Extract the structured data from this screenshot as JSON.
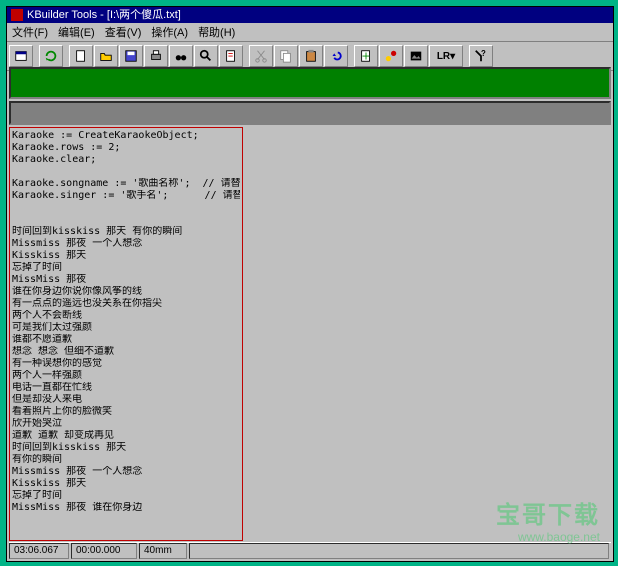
{
  "title": "KBuilder Tools - [I:\\两个傻瓜.txt]",
  "menu": [
    "文件(F)",
    "编辑(E)",
    "查看(V)",
    "操作(A)",
    "帮助(H)"
  ],
  "toolbar": {
    "lr": "LR"
  },
  "code": {
    "l1": "Karaoke := CreateKaraokeObject;",
    "l2": "Karaoke.rows := 2;",
    "l3": "Karaoke.clear;",
    "l4": "Karaoke.songname := '歌曲名称';  // 请替换歌曲名称",
    "l5": "Karaoke.singer := '歌手名';      // 请替换歌手姓名"
  },
  "lyrics": [
    "时间回到kisskiss 那天 有你的瞬间",
    "Missmiss 那夜 一个人想念",
    "Kisskiss 那天",
    "忘掉了时间",
    "MissMiss 那夜",
    "谁在你身边你说你像风筝的线",
    "有一点点的遥远也没关系在你指尖",
    "两个人不会断线",
    "可是我们太过强颜",
    "谁都不愿道歉",
    "想念 想念 但细不道歉",
    "有一种误想你的感觉",
    "两个人一样强颜",
    "电话一直都在忙线",
    "但是却没人来电",
    "看着照片上你的脸微笑",
    "欣开始哭泣",
    "道歉 道歉 却变成再见",
    "时间回到kisskiss 那天",
    "有你的瞬间",
    "Missmiss 那夜 一个人想念",
    "Kisskiss 那天",
    "忘掉了时间",
    "MissMiss 那夜 谁在你身边"
  ],
  "status": {
    "time1": "03:06.067",
    "time2": "00:00.000",
    "zoom": "40mm"
  },
  "watermark": {
    "t1": "宝哥下载",
    "t2": "www.baoge.net"
  }
}
